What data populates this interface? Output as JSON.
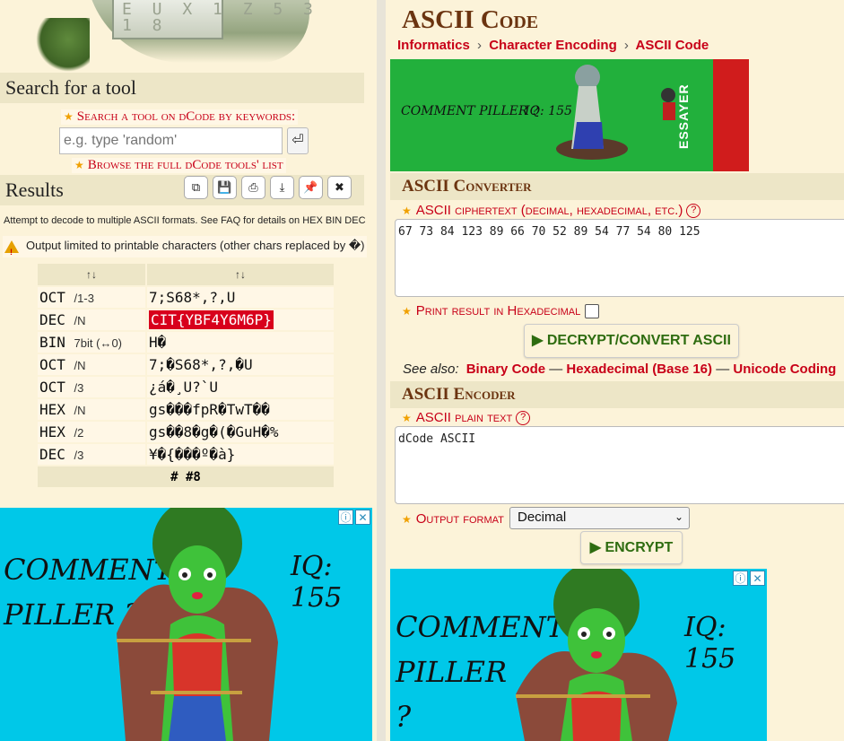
{
  "left": {
    "banner_image_text": "E U X 1 Z 5 3 1 8",
    "search_heading": "Search for a tool",
    "search_keywords_link": "Search a tool on dCode by keywords:",
    "search_placeholder": "e.g. type 'random'",
    "enter_symbol": "⏎",
    "browse_link": "Browse the full dCode tools' list",
    "results_heading": "Results",
    "toolbar": {
      "copy": "⧉",
      "save": "💾",
      "print": "⎙",
      "download": "⤓",
      "pin": "📌",
      "close": "✖"
    },
    "note": "Attempt to decode to multiple ASCII formats. See FAQ for details on HEX BIN DEC",
    "warning": "Output limited to printable characters (other chars replaced by �)",
    "table": {
      "headers": [
        "↑↓",
        "↑↓"
      ],
      "rows": [
        {
          "format": "OCT",
          "suffix": "/1-3",
          "value": "7;S68*,?,U"
        },
        {
          "format": "DEC",
          "suffix": "/N",
          "value": "CIT{YBF4Y6M6P}",
          "highlight": true
        },
        {
          "format": "BIN",
          "suffix": "7bit (↔0)",
          "value": "H�"
        },
        {
          "format": "OCT",
          "suffix": "/N",
          "value": "7;�S68*,?,�U"
        },
        {
          "format": "OCT",
          "suffix": "/3",
          "value": "¿á�¸U?`U"
        },
        {
          "format": "HEX",
          "suffix": "/N",
          "value": "gs���fpR�TwT��"
        },
        {
          "format": "HEX",
          "suffix": "/2",
          "value": "gs��8�g�(�GuH�%"
        },
        {
          "format": "DEC",
          "suffix": "/3",
          "value": "¥�{���º�à}"
        }
      ],
      "footer": "# #8"
    }
  },
  "ads": {
    "text_comment": "COMMENT PILLER ?",
    "text_iq": "IQ: 155",
    "small_comment": "COMMENT PILLER ?",
    "small_iq": "IQ: 155",
    "essayer": "ESSAYER",
    "info": "ⓘ",
    "close": "✕"
  },
  "right": {
    "title": "ASCII Code",
    "breadcrumbs": [
      "Informatics",
      "Character Encoding",
      "ASCII Code"
    ],
    "breadcrumb_sep": "›",
    "converter_heading": "ASCII Converter",
    "cipher_label": "ASCII ciphertext (decimal, hexadecimal, etc.)",
    "cipher_value": "67 73 84 123 89 66 70 52 89 54 77 54 80 125",
    "hex_label": "Print result in Hexadecimal",
    "decrypt_button": "▶ DECRYPT/CONVERT ASCII",
    "see_also_label": "See also:",
    "see_also": [
      "Binary Code",
      "Hexadecimal (Base 16)",
      "Unicode Coding"
    ],
    "see_also_sep": "—",
    "encoder_heading": "ASCII Encoder",
    "plain_label": "ASCII plain text",
    "plain_value": "dCode ASCII",
    "output_label": "Output format",
    "output_value": "Decimal",
    "encrypt_button": "▶ ENCRYPT",
    "help": "?"
  },
  "colors": {
    "page_bg": "#fcf3d9",
    "accent_red": "#c80018",
    "title_brown": "#6b3410",
    "button_green": "#2e6c10",
    "highlight": "#d8001c",
    "ad_teal": "#00c8e8",
    "ad_green": "#22b03c"
  }
}
